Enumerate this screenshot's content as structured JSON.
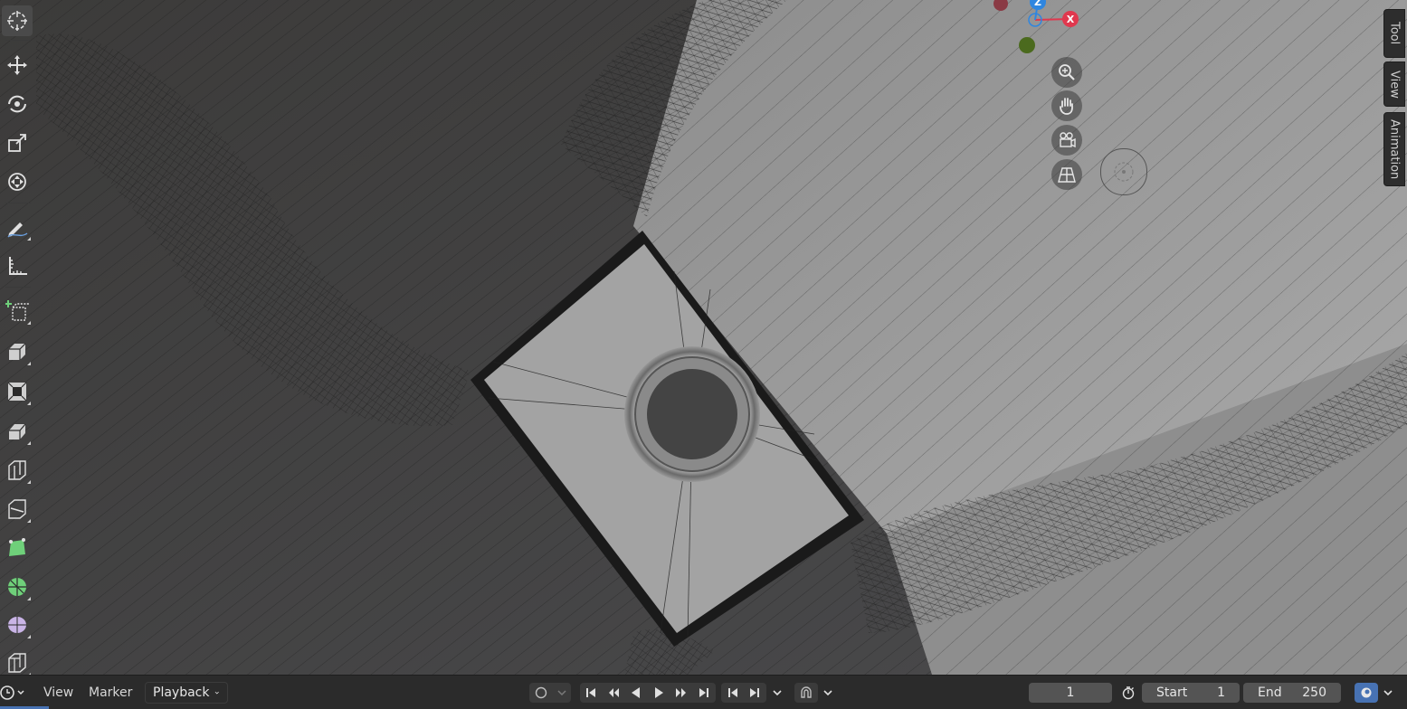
{
  "menus": {
    "editor_type_icon": "clock-icon",
    "view": "View",
    "marker": "Marker",
    "playback": "Playback"
  },
  "side_tabs": [
    "Tool",
    "View",
    "Animation"
  ],
  "gizmo": {
    "z_label": "Z",
    "x_label": "X"
  },
  "timeline": {
    "current_frame": "1",
    "start_label": "Start",
    "start_value": "1",
    "end_label": "End",
    "end_value": "250"
  },
  "tools": [
    "cursor-icon",
    "move-icon",
    "rotate-icon",
    "scale-icon",
    "transform-icon",
    "annotate-icon",
    "measure-icon",
    "add-cube-icon",
    "extrude-icon",
    "inset-icon",
    "bevel-icon",
    "loop-cut-icon",
    "knife-icon",
    "poly-build-icon",
    "spin-icon",
    "smooth-icon",
    "shear-icon"
  ],
  "colors": {
    "accent": "#4772b3",
    "x_axis": "#e0384e",
    "z_axis": "#2f86e0",
    "y_axis": "#6a9a2a"
  }
}
